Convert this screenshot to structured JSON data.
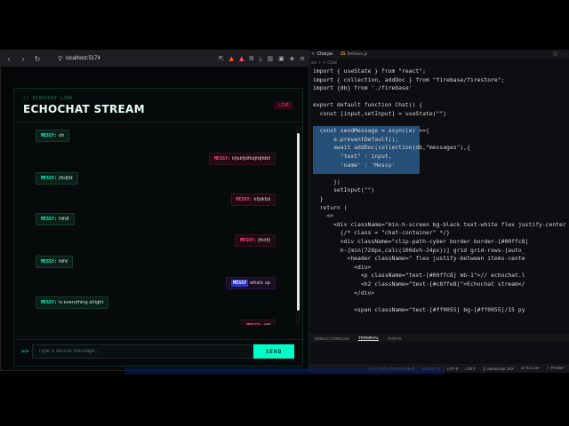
{
  "browser": {
    "url": "localhost:5174",
    "nav": {
      "back": "‹",
      "forward": "›",
      "reload": "↻"
    }
  },
  "app": {
    "kicker": "// ECHOCHAT.LINK",
    "title": "ECHOCHAT STREAM",
    "badge": "LIVE",
    "composer": {
      "prompt": ">>",
      "placeholder": "Type a secure message...",
      "send_label": "SEND"
    },
    "messages": [
      {
        "side": "left",
        "name": "MESSY:",
        "text": "oh"
      },
      {
        "side": "right",
        "name": "MESSY:",
        "text": "kfjskfjdfkdjfdjfdkf"
      },
      {
        "side": "left",
        "name": "MESSY:",
        "text": "jfkdjfd"
      },
      {
        "side": "right",
        "name": "MESSY:",
        "text": "kfjdkfjd"
      },
      {
        "side": "left",
        "name": "MESSY:",
        "text": "fdfdf"
      },
      {
        "side": "right",
        "name": "MESSY:",
        "text": "jfkdfjl"
      },
      {
        "side": "left",
        "name": "MESSY:",
        "text": "fdfd"
      },
      {
        "side": "right",
        "name": "MESSY",
        "text": "whats up",
        "highlight": true
      },
      {
        "side": "left",
        "name": "MESSY:",
        "text": "is everything alright"
      },
      {
        "side": "right",
        "name": "MESSY:",
        "text": "fdf"
      }
    ]
  },
  "editor": {
    "tabs": [
      {
        "label": "Chat.jsx",
        "icon": "react-icon",
        "active": true
      },
      {
        "label": "firebase.js",
        "icon": "js-icon",
        "active": false
      }
    ],
    "breadcrumb": "src > ⚛ Chat",
    "lines": [
      "import { useState } from \"react\";",
      "import { collection, addDoc } from \"firebase/firestore\";",
      "import {db} from './firebase'",
      "",
      "export default function Chat() {",
      "  const [input,setInput] = useState(\"\")",
      "",
      "  const sendMessage = async(e) =>{",
      "      e.preventDefault();",
      "      await addDoc(collection(db,\"messages\"),{",
      "        \"text\" : input,",
      "        'name' : 'Messy'",
      "",
      "      })",
      "      setInput(\"\")",
      "  }",
      "  return (",
      "    <>",
      "      <div className=\"min-h-screen bg-black text-white flex justify-center",
      "        {/* class = \"chat-container\" */}",
      "        <div className=\"clip-path-cyber border border-[#00ffc8]",
      "        h-[min(720px,calc(100dvh-24px))] grid grid-rows-[auto_",
      "          <header className=\" flex justify-between items-cente",
      "            <div>",
      "              <p className=\"text-[#00ffc8] mb-1\">// echochat.l",
      "              <h2 className=\"text-[#c8ffe8]\">Echochat stream</",
      "            </div>",
      "",
      "            <span className=\"text-[#ff0055] bg-[#ff0055]/15 py"
    ],
    "panel_tabs": [
      "DEBUG CONSOLE",
      "TERMINAL",
      "PORTS"
    ],
    "status": [
      "Ln 6, Col 1 (192 selected)",
      "Spaces: 2",
      "UTF-8",
      "CRLF",
      "{} JavaScript JSX",
      "⊘ Go Live",
      "✓ Prettier"
    ]
  }
}
